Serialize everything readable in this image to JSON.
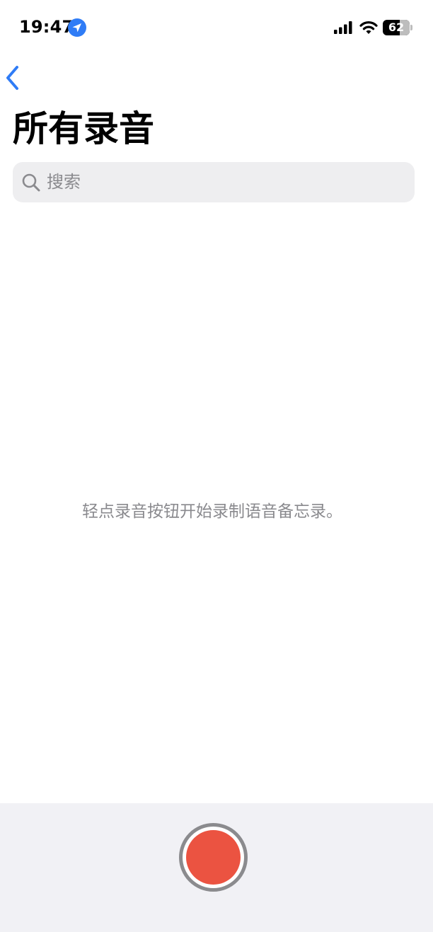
{
  "status_bar": {
    "time": "19:47",
    "battery_level": "62",
    "battery_fraction": 0.62,
    "icons": [
      "location-arrow-icon",
      "cellular-signal-icon",
      "wifi-icon",
      "battery-icon"
    ]
  },
  "nav": {
    "back_icon": "chevron-left-icon"
  },
  "page": {
    "title": "所有录音"
  },
  "search": {
    "placeholder": "搜索",
    "icon": "magnifying-glass-icon"
  },
  "empty_state": {
    "message": "轻点录音按钮开始录制语音备忘录。"
  },
  "toolbar": {
    "record_icon": "record-button-icon"
  },
  "colors": {
    "accent": "#2f7cf6",
    "record": "#eb5341",
    "toolbar_bg": "#f1f1f5",
    "search_bg": "#eeeef0",
    "secondary_text": "#8a8a8e"
  }
}
